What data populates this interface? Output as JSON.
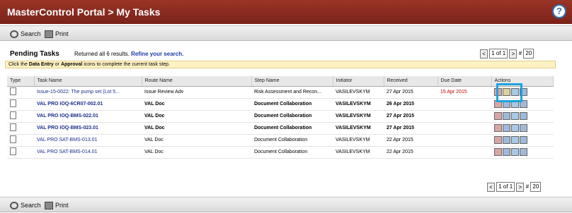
{
  "header": {
    "title": "MasterControl Portal > My Tasks",
    "help_label": "?"
  },
  "toolbar": {
    "search_label": "Search",
    "print_label": "Print"
  },
  "section": {
    "title": "Pending Tasks",
    "returned_text": "Returned all 6 results.",
    "refine_link": "Refine your search."
  },
  "pager": {
    "page_value": "1 of 1",
    "hash_label": "#",
    "per_page": "20",
    "prev": "<",
    "next": ">"
  },
  "instruction": {
    "part1": "Click the ",
    "data_entry": "Data Entry",
    "part2": " or ",
    "approval": "Approval",
    "part3": " icons to complete the current task step."
  },
  "table": {
    "columns": [
      "Type",
      "Task Name",
      "Route Name",
      "Step Name",
      "Initiator",
      "Received",
      "Due Date",
      "Actions"
    ],
    "rows": [
      {
        "task": "Issue-15-0022: The pump set (Lot 5...",
        "route": "Issue Review Adv",
        "step": "Risk Assessment and Recon...",
        "initiator": "VASILEVSKYM",
        "received": "27 Apr 2015",
        "due": "15 Apr 2015",
        "bold": false
      },
      {
        "task": "VAL PRO IOQ-6CR07-002.01",
        "route": "VAL Doc",
        "step": "Document Collaboration",
        "initiator": "VASILEVSKYM",
        "received": "26 Apr 2015",
        "due": "",
        "bold": true
      },
      {
        "task": "VAL PRO IOQ-BMS-022.01",
        "route": "VAL Doc",
        "step": "Document Collaboration",
        "initiator": "VASILEVSKYM",
        "received": "27 Apr 2015",
        "due": "",
        "bold": true
      },
      {
        "task": "VAL PRO IOQ-BMS-023.01",
        "route": "VAL Doc",
        "step": "Document Collaboration",
        "initiator": "VASILEVSKYM",
        "received": "27 Apr 2015",
        "due": "",
        "bold": true
      },
      {
        "task": "VAL PRO SAT-BMS-013.01",
        "route": "VAL Doc",
        "step": "Document Collaboration",
        "initiator": "VASILEVSKYM",
        "received": "22 Apr 2015",
        "due": "",
        "bold": false
      },
      {
        "task": "VAL PRO SAT-BMS-014.01",
        "route": "VAL Doc",
        "step": "Document Collaboration",
        "initiator": "VASILEVSKYM",
        "received": "22 Apr 2015",
        "due": "",
        "bold": false
      }
    ]
  }
}
